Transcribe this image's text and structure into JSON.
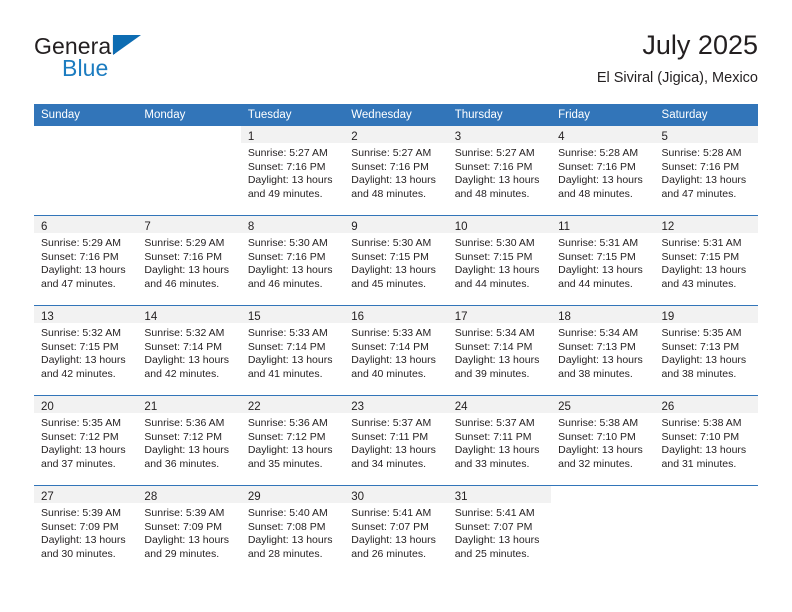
{
  "brand": {
    "line1": "General",
    "line2": "Blue",
    "triangle_color": "#0d6cb2",
    "blue_text_color": "#1c7cc0"
  },
  "header": {
    "title": "July 2025",
    "subtitle": "El Siviral (Jigica), Mexico"
  },
  "theme": {
    "header_blue": "#3275b9",
    "daynum_band_gray": "#f2f2f2",
    "text_color": "#231f20"
  },
  "weekday_headers": [
    "Sunday",
    "Monday",
    "Tuesday",
    "Wednesday",
    "Thursday",
    "Friday",
    "Saturday"
  ],
  "labels": {
    "sunrise_prefix": "Sunrise:",
    "sunset_prefix": "Sunset:",
    "daylight_prefix": "Daylight:"
  },
  "weeks": [
    [
      {
        "day": "",
        "line1": "",
        "line2": "",
        "line3": "",
        "line4": "",
        "blank": true
      },
      {
        "day": "",
        "line1": "",
        "line2": "",
        "line3": "",
        "line4": "",
        "blank": true
      },
      {
        "day": "1",
        "line1": "Sunrise: 5:27 AM",
        "line2": "Sunset: 7:16 PM",
        "line3": "Daylight: 13 hours",
        "line4": "and 49 minutes."
      },
      {
        "day": "2",
        "line1": "Sunrise: 5:27 AM",
        "line2": "Sunset: 7:16 PM",
        "line3": "Daylight: 13 hours",
        "line4": "and 48 minutes."
      },
      {
        "day": "3",
        "line1": "Sunrise: 5:27 AM",
        "line2": "Sunset: 7:16 PM",
        "line3": "Daylight: 13 hours",
        "line4": "and 48 minutes."
      },
      {
        "day": "4",
        "line1": "Sunrise: 5:28 AM",
        "line2": "Sunset: 7:16 PM",
        "line3": "Daylight: 13 hours",
        "line4": "and 48 minutes."
      },
      {
        "day": "5",
        "line1": "Sunrise: 5:28 AM",
        "line2": "Sunset: 7:16 PM",
        "line3": "Daylight: 13 hours",
        "line4": "and 47 minutes."
      }
    ],
    [
      {
        "day": "6",
        "line1": "Sunrise: 5:29 AM",
        "line2": "Sunset: 7:16 PM",
        "line3": "Daylight: 13 hours",
        "line4": "and 47 minutes."
      },
      {
        "day": "7",
        "line1": "Sunrise: 5:29 AM",
        "line2": "Sunset: 7:16 PM",
        "line3": "Daylight: 13 hours",
        "line4": "and 46 minutes."
      },
      {
        "day": "8",
        "line1": "Sunrise: 5:30 AM",
        "line2": "Sunset: 7:16 PM",
        "line3": "Daylight: 13 hours",
        "line4": "and 46 minutes."
      },
      {
        "day": "9",
        "line1": "Sunrise: 5:30 AM",
        "line2": "Sunset: 7:15 PM",
        "line3": "Daylight: 13 hours",
        "line4": "and 45 minutes."
      },
      {
        "day": "10",
        "line1": "Sunrise: 5:30 AM",
        "line2": "Sunset: 7:15 PM",
        "line3": "Daylight: 13 hours",
        "line4": "and 44 minutes."
      },
      {
        "day": "11",
        "line1": "Sunrise: 5:31 AM",
        "line2": "Sunset: 7:15 PM",
        "line3": "Daylight: 13 hours",
        "line4": "and 44 minutes."
      },
      {
        "day": "12",
        "line1": "Sunrise: 5:31 AM",
        "line2": "Sunset: 7:15 PM",
        "line3": "Daylight: 13 hours",
        "line4": "and 43 minutes."
      }
    ],
    [
      {
        "day": "13",
        "line1": "Sunrise: 5:32 AM",
        "line2": "Sunset: 7:15 PM",
        "line3": "Daylight: 13 hours",
        "line4": "and 42 minutes."
      },
      {
        "day": "14",
        "line1": "Sunrise: 5:32 AM",
        "line2": "Sunset: 7:14 PM",
        "line3": "Daylight: 13 hours",
        "line4": "and 42 minutes."
      },
      {
        "day": "15",
        "line1": "Sunrise: 5:33 AM",
        "line2": "Sunset: 7:14 PM",
        "line3": "Daylight: 13 hours",
        "line4": "and 41 minutes."
      },
      {
        "day": "16",
        "line1": "Sunrise: 5:33 AM",
        "line2": "Sunset: 7:14 PM",
        "line3": "Daylight: 13 hours",
        "line4": "and 40 minutes."
      },
      {
        "day": "17",
        "line1": "Sunrise: 5:34 AM",
        "line2": "Sunset: 7:14 PM",
        "line3": "Daylight: 13 hours",
        "line4": "and 39 minutes."
      },
      {
        "day": "18",
        "line1": "Sunrise: 5:34 AM",
        "line2": "Sunset: 7:13 PM",
        "line3": "Daylight: 13 hours",
        "line4": "and 38 minutes."
      },
      {
        "day": "19",
        "line1": "Sunrise: 5:35 AM",
        "line2": "Sunset: 7:13 PM",
        "line3": "Daylight: 13 hours",
        "line4": "and 38 minutes."
      }
    ],
    [
      {
        "day": "20",
        "line1": "Sunrise: 5:35 AM",
        "line2": "Sunset: 7:12 PM",
        "line3": "Daylight: 13 hours",
        "line4": "and 37 minutes."
      },
      {
        "day": "21",
        "line1": "Sunrise: 5:36 AM",
        "line2": "Sunset: 7:12 PM",
        "line3": "Daylight: 13 hours",
        "line4": "and 36 minutes."
      },
      {
        "day": "22",
        "line1": "Sunrise: 5:36 AM",
        "line2": "Sunset: 7:12 PM",
        "line3": "Daylight: 13 hours",
        "line4": "and 35 minutes."
      },
      {
        "day": "23",
        "line1": "Sunrise: 5:37 AM",
        "line2": "Sunset: 7:11 PM",
        "line3": "Daylight: 13 hours",
        "line4": "and 34 minutes."
      },
      {
        "day": "24",
        "line1": "Sunrise: 5:37 AM",
        "line2": "Sunset: 7:11 PM",
        "line3": "Daylight: 13 hours",
        "line4": "and 33 minutes."
      },
      {
        "day": "25",
        "line1": "Sunrise: 5:38 AM",
        "line2": "Sunset: 7:10 PM",
        "line3": "Daylight: 13 hours",
        "line4": "and 32 minutes."
      },
      {
        "day": "26",
        "line1": "Sunrise: 5:38 AM",
        "line2": "Sunset: 7:10 PM",
        "line3": "Daylight: 13 hours",
        "line4": "and 31 minutes."
      }
    ],
    [
      {
        "day": "27",
        "line1": "Sunrise: 5:39 AM",
        "line2": "Sunset: 7:09 PM",
        "line3": "Daylight: 13 hours",
        "line4": "and 30 minutes."
      },
      {
        "day": "28",
        "line1": "Sunrise: 5:39 AM",
        "line2": "Sunset: 7:09 PM",
        "line3": "Daylight: 13 hours",
        "line4": "and 29 minutes."
      },
      {
        "day": "29",
        "line1": "Sunrise: 5:40 AM",
        "line2": "Sunset: 7:08 PM",
        "line3": "Daylight: 13 hours",
        "line4": "and 28 minutes."
      },
      {
        "day": "30",
        "line1": "Sunrise: 5:41 AM",
        "line2": "Sunset: 7:07 PM",
        "line3": "Daylight: 13 hours",
        "line4": "and 26 minutes."
      },
      {
        "day": "31",
        "line1": "Sunrise: 5:41 AM",
        "line2": "Sunset: 7:07 PM",
        "line3": "Daylight: 13 hours",
        "line4": "and 25 minutes."
      },
      {
        "day": "",
        "line1": "",
        "line2": "",
        "line3": "",
        "line4": "",
        "blank": true
      },
      {
        "day": "",
        "line1": "",
        "line2": "",
        "line3": "",
        "line4": "",
        "blank": true
      }
    ]
  ]
}
